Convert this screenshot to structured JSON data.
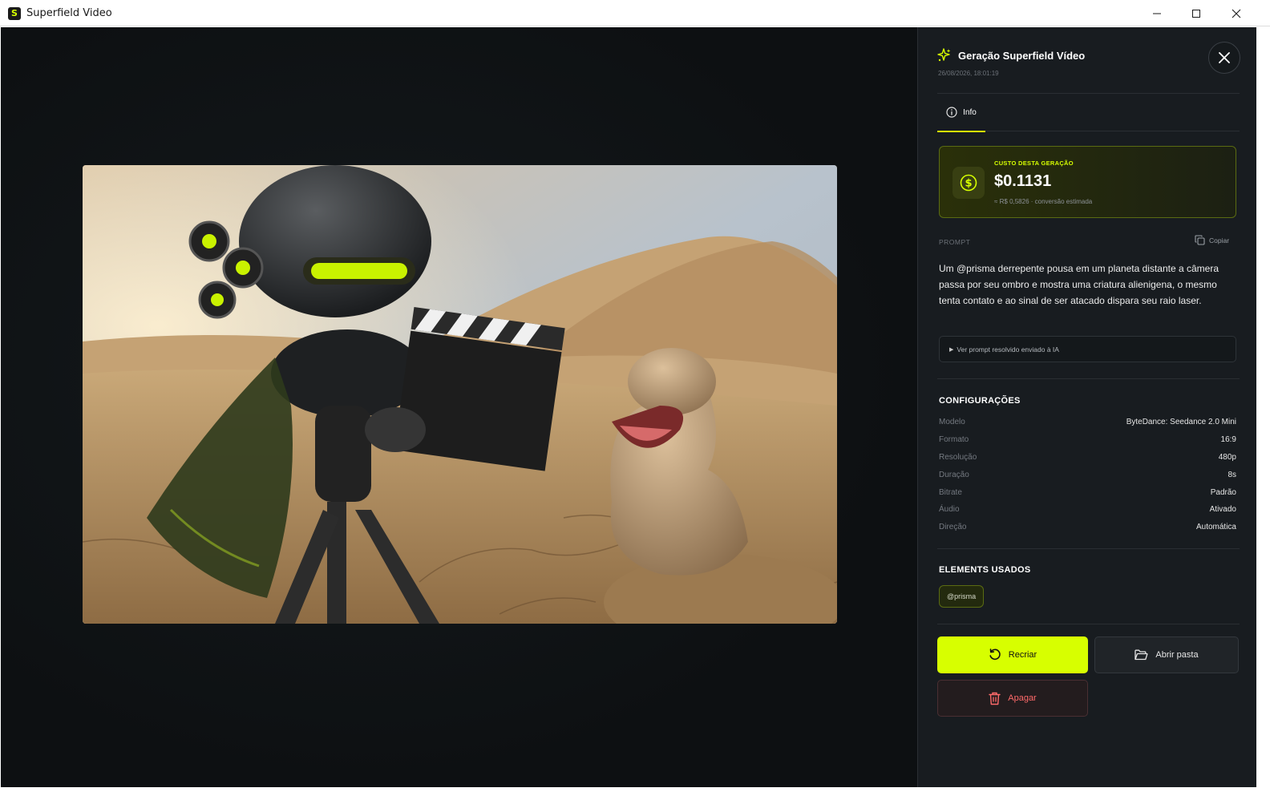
{
  "window": {
    "app_icon": "S",
    "title": "Superfield Video",
    "controls": [
      "minimize-icon",
      "maximize-icon",
      "close-icon"
    ]
  },
  "panel": {
    "title": "Geração Superfield Vídeo",
    "date": "26/08/2026, 18:01:19",
    "tabs": [
      {
        "label": "Info",
        "icon": "info-icon",
        "active": true
      }
    ],
    "cost": {
      "label": "CUSTO DESTA GERAÇÃO",
      "value": "$0.1131",
      "conversion": "≈ R$ 0,5826 · conversão estimada",
      "icon": "dollar-coin-icon"
    },
    "prompt": {
      "label": "PROMPT",
      "copy_label": "Copiar",
      "text": "Um @prisma derrepente pousa em um planeta distante a câmera passa por seu ombro e mostra uma criatura alienigena, o mesmo tenta contato e ao sinal de ser atacado dispara seu raio laser.",
      "resolved_toggle": "Ver prompt resolvido enviado à IA"
    },
    "config": {
      "title": "CONFIGURAÇÕES",
      "rows": [
        {
          "key": "Modelo",
          "value": "ByteDance: Seedance 2.0 Mini"
        },
        {
          "key": "Formato",
          "value": "16:9"
        },
        {
          "key": "Resolução",
          "value": "480p"
        },
        {
          "key": "Duração",
          "value": "8s"
        },
        {
          "key": "Bitrate",
          "value": "Padrão"
        },
        {
          "key": "Áudio",
          "value": "Ativado"
        },
        {
          "key": "Direção",
          "value": "Automática"
        }
      ]
    },
    "elements": {
      "title": "ELEMENTS USADOS",
      "items": [
        "@prisma"
      ]
    },
    "actions": {
      "recreate": "Recriar",
      "open_folder": "Abrir pasta",
      "delete": "Apagar"
    }
  },
  "colors": {
    "accent": "#d7ff00",
    "panel_bg": "#181c20",
    "viewer_bg": "#0d1012",
    "danger": "#ff6a6a"
  }
}
